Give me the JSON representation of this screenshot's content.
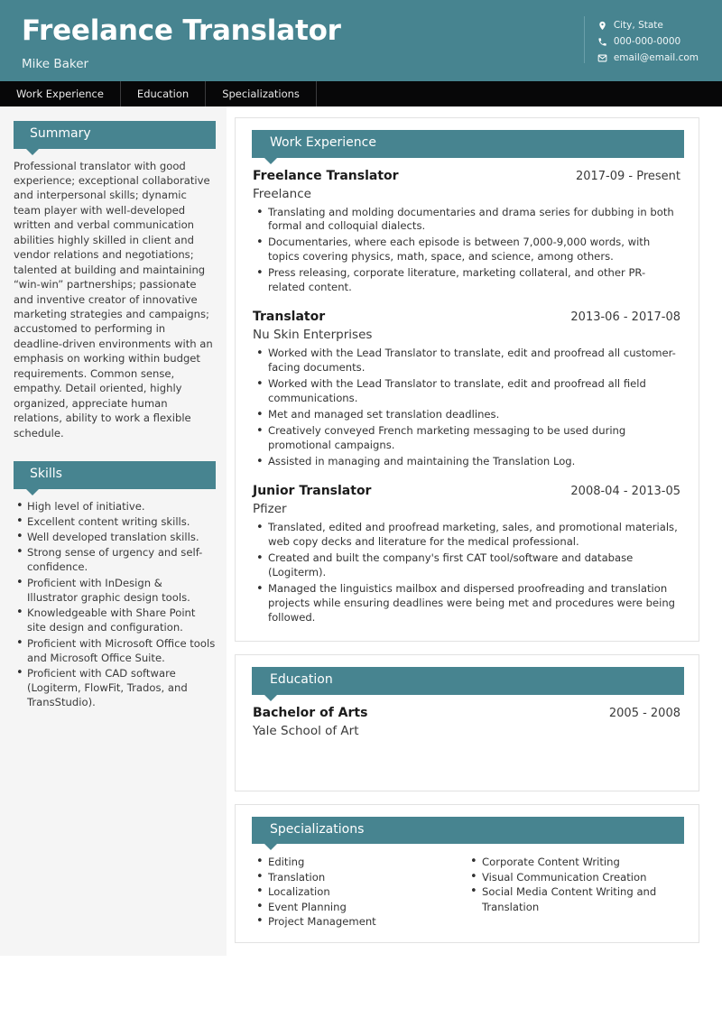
{
  "theme": {
    "accent": "#478490",
    "nav_bg": "#070708",
    "sidebar_bg": "#f5f5f5",
    "page_bg": "#ffffff",
    "text": "#333333"
  },
  "header": {
    "title": "Freelance Translator",
    "name": "Mike Baker",
    "contacts": [
      {
        "icon": "location-pin-icon",
        "value": "City, State"
      },
      {
        "icon": "phone-icon",
        "value": "000-000-0000"
      },
      {
        "icon": "envelope-icon",
        "value": "email@email.com"
      }
    ]
  },
  "nav": {
    "items": [
      {
        "label": "Work Experience"
      },
      {
        "label": "Education"
      },
      {
        "label": "Specializations"
      }
    ]
  },
  "sidebar": {
    "summary": {
      "heading": "Summary",
      "text": "Professional translator with good experience; exceptional collaborative and interpersonal skills; dynamic team player with well-developed written and verbal communication abilities highly skilled in client and vendor relations and negotiations; talented at building and maintaining “win-win” partnerships; passionate and inventive creator of innovative marketing strategies and campaigns; accustomed to performing in deadline-driven environments with an emphasis on working within budget requirements. Common sense, empathy. Detail oriented, highly organized, appreciate human relations, ability to work a flexible schedule."
    },
    "skills": {
      "heading": "Skills",
      "items": [
        "High level of initiative.",
        "Excellent content writing skills.",
        "Well developed translation skills.",
        "Strong sense of urgency and self-confidence.",
        "Proficient with InDesign & Illustrator graphic design tools.",
        "Knowledgeable with Share Point site design and configuration.",
        "Proficient with Microsoft Office tools and Microsoft Office Suite.",
        "Proficient with CAD software (Logiterm, FlowFit, Trados, and TransStudio)."
      ]
    }
  },
  "work_experience": {
    "heading": "Work Experience",
    "entries": [
      {
        "title": "Freelance Translator",
        "dates": "2017-09 - Present",
        "organization": "Freelance",
        "bullets": [
          "Translating and molding documentaries and drama series for dubbing in both formal and colloquial dialects.",
          "Documentaries, where each episode is between 7,000-9,000 words, with topics covering physics, math, space, and science, among others.",
          "Press releasing, corporate literature, marketing collateral, and other PR-related content."
        ]
      },
      {
        "title": "Translator",
        "dates": "2013-06 - 2017-08",
        "organization": "Nu Skin Enterprises",
        "bullets": [
          "Worked with the Lead Translator to translate, edit and proofread all customer-facing documents.",
          "Worked with the Lead Translator to translate, edit and proofread all field communications.",
          "Met and managed set translation deadlines.",
          "Creatively conveyed French marketing messaging to be used during promotional campaigns.",
          "Assisted in managing and maintaining the Translation Log."
        ]
      },
      {
        "title": "Junior Translator",
        "dates": "2008-04 - 2013-05",
        "organization": "Pfizer",
        "bullets": [
          "Translated, edited and proofread marketing, sales, and promotional materials, web copy decks and literature for the medical professional.",
          "Created and built the company's first CAT tool/software and database (Logiterm).",
          "Managed the linguistics mailbox and dispersed proofreading and translation projects while ensuring deadlines were being met and procedures were being followed."
        ]
      }
    ]
  },
  "education": {
    "heading": "Education",
    "entries": [
      {
        "title": "Bachelor of Arts",
        "dates": "2005 - 2008",
        "organization": "Yale School of Art"
      }
    ]
  },
  "specializations": {
    "heading": "Specializations",
    "column_left": [
      "Editing",
      "Translation",
      "Localization",
      "Event Planning",
      "Project Management"
    ],
    "column_right": [
      "Corporate Content Writing",
      "Visual Communication Creation",
      "Social Media Content Writing and Translation"
    ]
  }
}
